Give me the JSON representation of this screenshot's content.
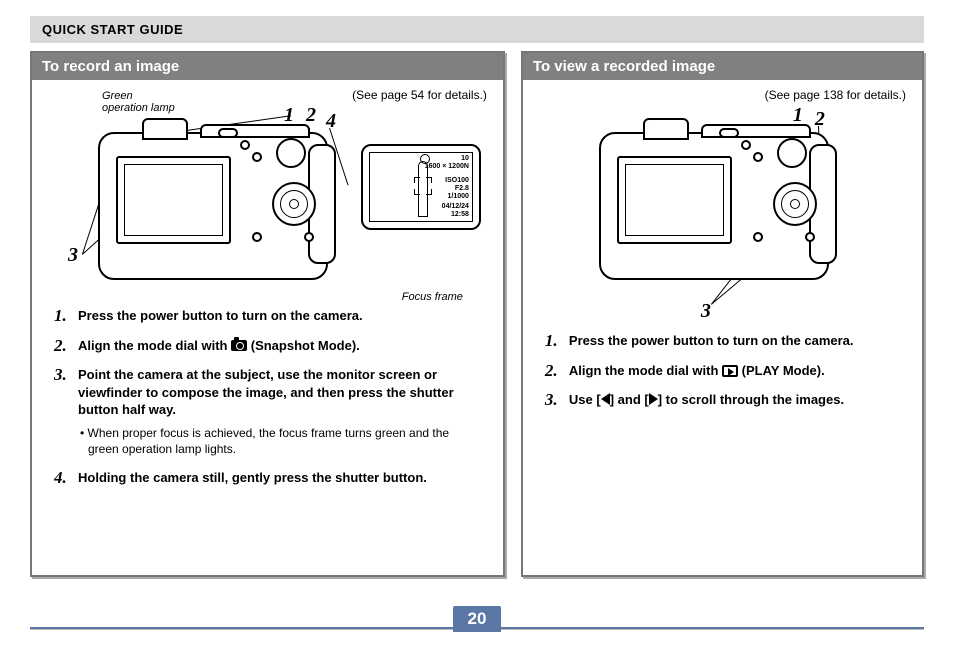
{
  "header": "QUICK START GUIDE",
  "page_number": "20",
  "left": {
    "title": "To record an image",
    "see_page": "(See page 54 for details.)",
    "caption_lamp": "Green\noperation lamp",
    "focus_caption": "Focus frame",
    "callouts": {
      "c1": "1",
      "c2": "2",
      "c3": "3",
      "c4": "4"
    },
    "lcd": {
      "shots": "10",
      "res": "1600 × 1200N",
      "iso": "ISO100",
      "f": "F2.8",
      "speed": "1/1000",
      "date": "04/12/24",
      "time": "12:58"
    },
    "steps": {
      "s1": "Press the power button to turn on the camera.",
      "s2a": "Align the mode dial with ",
      "s2b": " (Snapshot Mode).",
      "s3": "Point the camera at the subject, use the monitor screen or viewfinder to compose the image, and then press the shutter button half way.",
      "s3_sub": "When proper focus is achieved, the focus frame turns green and the green operation lamp lights.",
      "s4": "Holding the camera still, gently press the shutter button."
    }
  },
  "right": {
    "title": "To view a recorded image",
    "see_page": "(See page 138 for details.)",
    "callouts": {
      "c1": "1",
      "c2": "2",
      "c3": "3"
    },
    "steps": {
      "s1": "Press the power button to turn on the camera.",
      "s2a": "Align the mode dial with ",
      "s2b": " (PLAY Mode).",
      "s3a": "Use [",
      "s3b": "] and [",
      "s3c": "] to scroll through the images."
    }
  }
}
